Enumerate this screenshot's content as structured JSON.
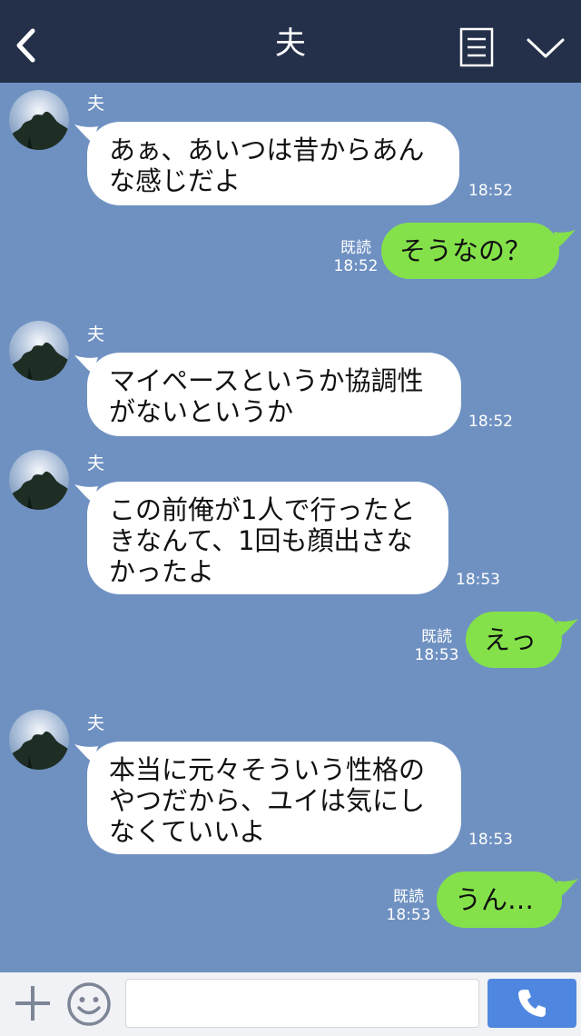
{
  "header": {
    "title": "夫",
    "back_icon": "chevron-left-icon",
    "menu_icon": "notes-icon",
    "more_icon": "chevron-down-icon",
    "background": "#243049"
  },
  "chat": {
    "background": "#6f91c2",
    "messages": [
      {
        "side": "in",
        "sender": "夫",
        "text": "あぁ、あいつは昔からあん\nな感じだよ",
        "time": "18:52"
      },
      {
        "side": "out",
        "read": "既読",
        "text": "そうなの？",
        "time": "18:52"
      },
      {
        "side": "in",
        "sender": "夫",
        "text": "マイペースというか協調性\nがないというか",
        "time": "18:52"
      },
      {
        "side": "in",
        "sender": "夫",
        "text": "この前俺が1人で行ったと\nきなんて、1回も顔出さな\nかったよ",
        "time": "18:53"
      },
      {
        "side": "out",
        "read": "既読",
        "text": "えっ",
        "time": "18:53"
      },
      {
        "side": "in",
        "sender": "夫",
        "text": "本当に元々そういう性格の\nやつだから、ユイは気にし\nなくていいよ",
        "time": "18:53"
      },
      {
        "side": "out",
        "read": "既読",
        "text": "うん…",
        "time": "18:53"
      }
    ]
  },
  "colors": {
    "outgoing_bubble": "#84e14a",
    "incoming_bubble": "#ffffff",
    "call_button": "#4f87e0"
  },
  "input_bar": {
    "plus_icon": "plus-icon",
    "emoji_icon": "emoji-icon",
    "message_value": "",
    "call_icon": "phone-icon"
  }
}
